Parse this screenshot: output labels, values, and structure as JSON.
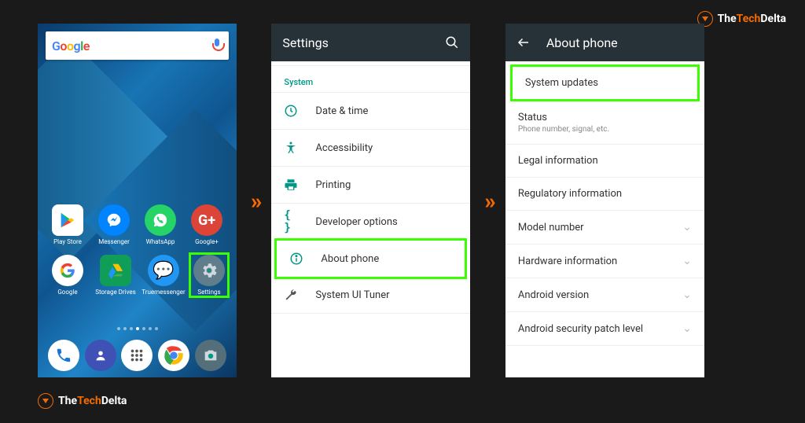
{
  "brand": {
    "part1": "The",
    "part2": "Tech",
    "part3": "Delta"
  },
  "arrow_glyph": "»",
  "screen1": {
    "search_brand": "Google",
    "apps_row1": [
      {
        "label": "Play Store",
        "icon": "play-store-icon",
        "cls": "ic-play"
      },
      {
        "label": "Messenger",
        "icon": "messenger-icon",
        "cls": "ic-mess"
      },
      {
        "label": "WhatsApp",
        "icon": "whatsapp-icon",
        "cls": "ic-wa"
      },
      {
        "label": "Google+",
        "icon": "google-plus-icon",
        "cls": "ic-gp"
      }
    ],
    "apps_row2": [
      {
        "label": "Google",
        "icon": "google-icon",
        "cls": "ic-goog"
      },
      {
        "label": "Storage Drives",
        "icon": "drive-icon",
        "cls": "ic-drv"
      },
      {
        "label": "Truemessenger",
        "icon": "truemessenger-icon",
        "cls": "ic-tmsg"
      },
      {
        "label": "Settings",
        "icon": "settings-gear-icon",
        "cls": "ic-set",
        "highlight": true
      }
    ],
    "dock": [
      {
        "icon": "phone-icon",
        "cls": "ic-phone"
      },
      {
        "icon": "contacts-icon",
        "cls": "ic-cont"
      },
      {
        "icon": "apps-drawer-icon",
        "cls": "ic-apps"
      },
      {
        "icon": "chrome-icon",
        "cls": "ic-chrome"
      },
      {
        "icon": "camera-icon",
        "cls": "ic-cam"
      }
    ]
  },
  "screen2": {
    "title": "Settings",
    "section": "System",
    "items": [
      {
        "label": "Date & time",
        "icon": "clock-icon"
      },
      {
        "label": "Accessibility",
        "icon": "accessibility-icon"
      },
      {
        "label": "Printing",
        "icon": "print-icon"
      },
      {
        "label": "Developer options",
        "icon": "braces-icon"
      },
      {
        "label": "About phone",
        "icon": "info-icon",
        "highlight": true
      },
      {
        "label": "System UI Tuner",
        "icon": "wrench-icon"
      }
    ]
  },
  "screen3": {
    "title": "About phone",
    "items": [
      {
        "label": "System updates",
        "highlight": true
      },
      {
        "label": "Status",
        "sub": "Phone number, signal, etc."
      },
      {
        "label": "Legal information"
      },
      {
        "label": "Regulatory information"
      },
      {
        "label": "Model number",
        "chevron": true
      },
      {
        "label": "Hardware information",
        "chevron": true
      },
      {
        "label": "Android version",
        "chevron": true
      },
      {
        "label": "Android security patch level",
        "chevron": true
      }
    ]
  }
}
